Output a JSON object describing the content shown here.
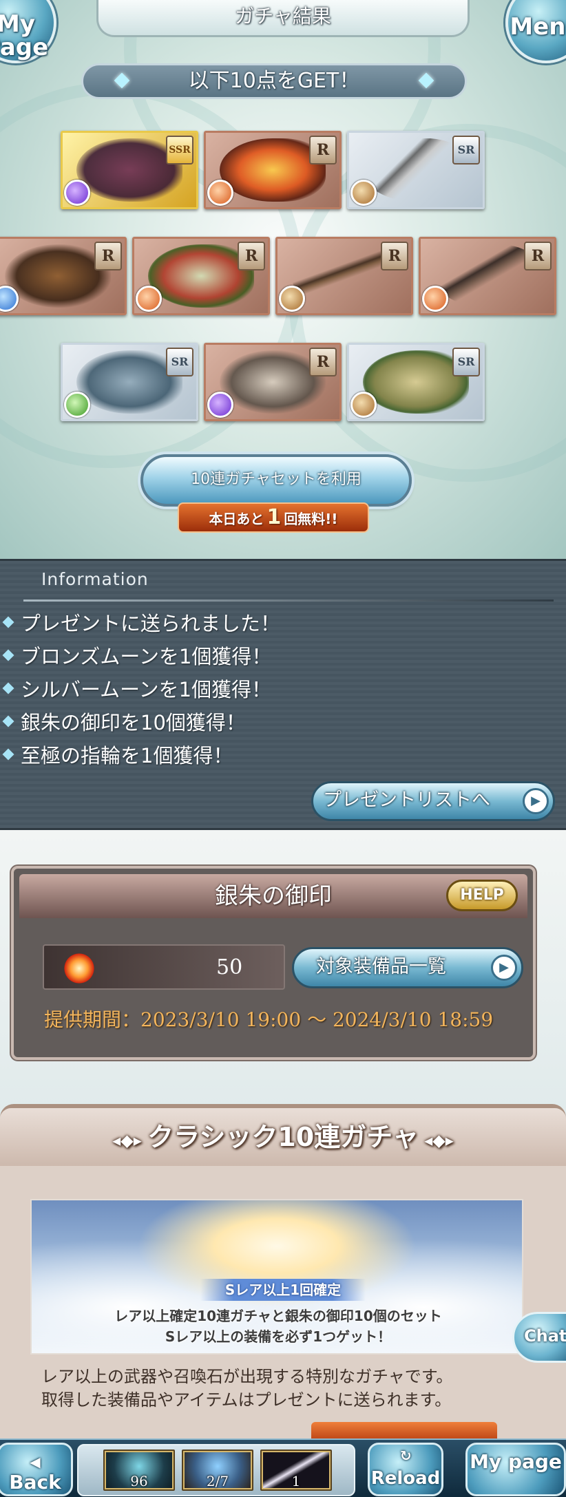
{
  "header": {
    "title": "ガチャ結果",
    "mypage_label": "My Page",
    "menu_label": "Menu"
  },
  "result": {
    "banner": "以下10点をGET！",
    "items": [
      {
        "rarity": "SSR",
        "element": "dark"
      },
      {
        "rarity": "R",
        "element": "fire"
      },
      {
        "rarity": "SR",
        "element": "earth"
      },
      {
        "rarity": "R",
        "element": "water"
      },
      {
        "rarity": "R",
        "element": "fire"
      },
      {
        "rarity": "R",
        "element": "earth"
      },
      {
        "rarity": "R",
        "element": "fire"
      },
      {
        "rarity": "SR",
        "element": "wind"
      },
      {
        "rarity": "R",
        "element": "dark"
      },
      {
        "rarity": "SR",
        "element": "earth"
      }
    ],
    "draw_button": "10連ガチャセットを利用",
    "free_prefix": "本日あと",
    "free_count": "1",
    "free_suffix": "回無料!!"
  },
  "information": {
    "title": "Information",
    "lines": [
      "プレゼントに送られました！",
      "ブロンズムーンを1個獲得！",
      "シルバームーンを1個獲得！",
      "銀朱の御印を10個獲得！",
      "至極の指輪を1個獲得！"
    ],
    "present_list_button": "プレゼントリストへ"
  },
  "seal": {
    "title": "銀朱の御印",
    "help_label": "HELP",
    "count": "50",
    "equip_list_button": "対象装備品一覧",
    "period_label": "提供期間：",
    "period_value": "2023/3/10 19:00 〜 2024/3/10 18:59"
  },
  "classic": {
    "title": "クラシック10連ガチャ",
    "banner_tag": "Sレア以上1回確定",
    "banner_line1": "レア以上確定10連ガチャと銀朱の御印10個のセット",
    "banner_line2": "Sレア以上の装備を必ず1つゲット！",
    "desc_line1": "レア以上の武器や召喚石が出現する特別なガチャです。",
    "desc_line2": "取得した装備品やアイテムはプレゼントに送られます。"
  },
  "chat_label": "Chat",
  "bottom_bar": {
    "back_label": "Back",
    "reload_label": "Reload",
    "mypage_label": "My page",
    "tray": [
      {
        "qty": "96"
      },
      {
        "qty": "2/7"
      },
      {
        "qty": "1"
      }
    ]
  },
  "colors": {
    "accent_blue": "#4c98bd",
    "free_badge": "#c24a16",
    "period_text": "#f3b55c",
    "info_bg": "#4c5b66"
  }
}
